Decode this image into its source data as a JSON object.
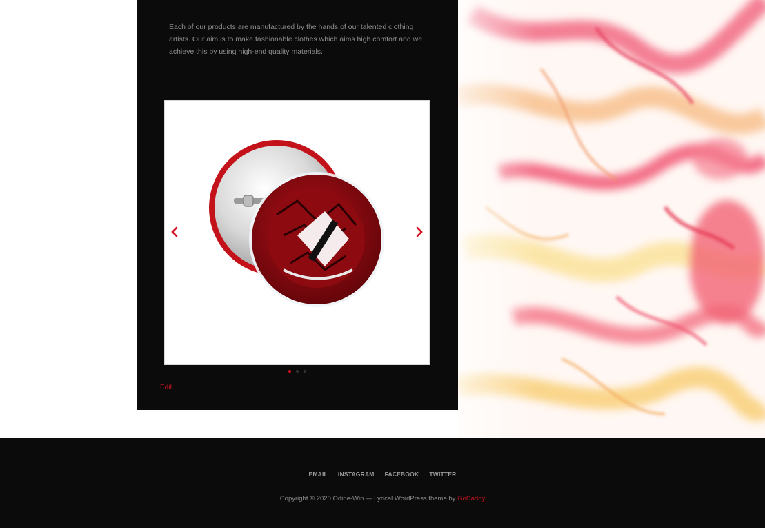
{
  "about": {
    "description": "Each of our products are manufactured by the hands of our talented clothing artists. Our aim is to make fashionable clothes which aims high comfort and we achieve this by using high-end quality materials."
  },
  "carousel": {
    "image_icon": "pin-button-image",
    "prev_icon": "chevron-left-icon",
    "next_icon": "chevron-right-icon",
    "slide_count": 3,
    "active_slide": 1
  },
  "edit_label": "Edit",
  "footer": {
    "nav": [
      "EMAIL",
      "INSTAGRAM",
      "FACEBOOK",
      "TWITTER"
    ],
    "copyright_text": "Copyright © 2020 Odine-Win — Lyrical WordPress theme by",
    "credit_link": "GoDaddy"
  },
  "colors": {
    "accent": "#d4121f",
    "panel": "#0b0b0b",
    "text_muted": "#8e8e8e"
  }
}
